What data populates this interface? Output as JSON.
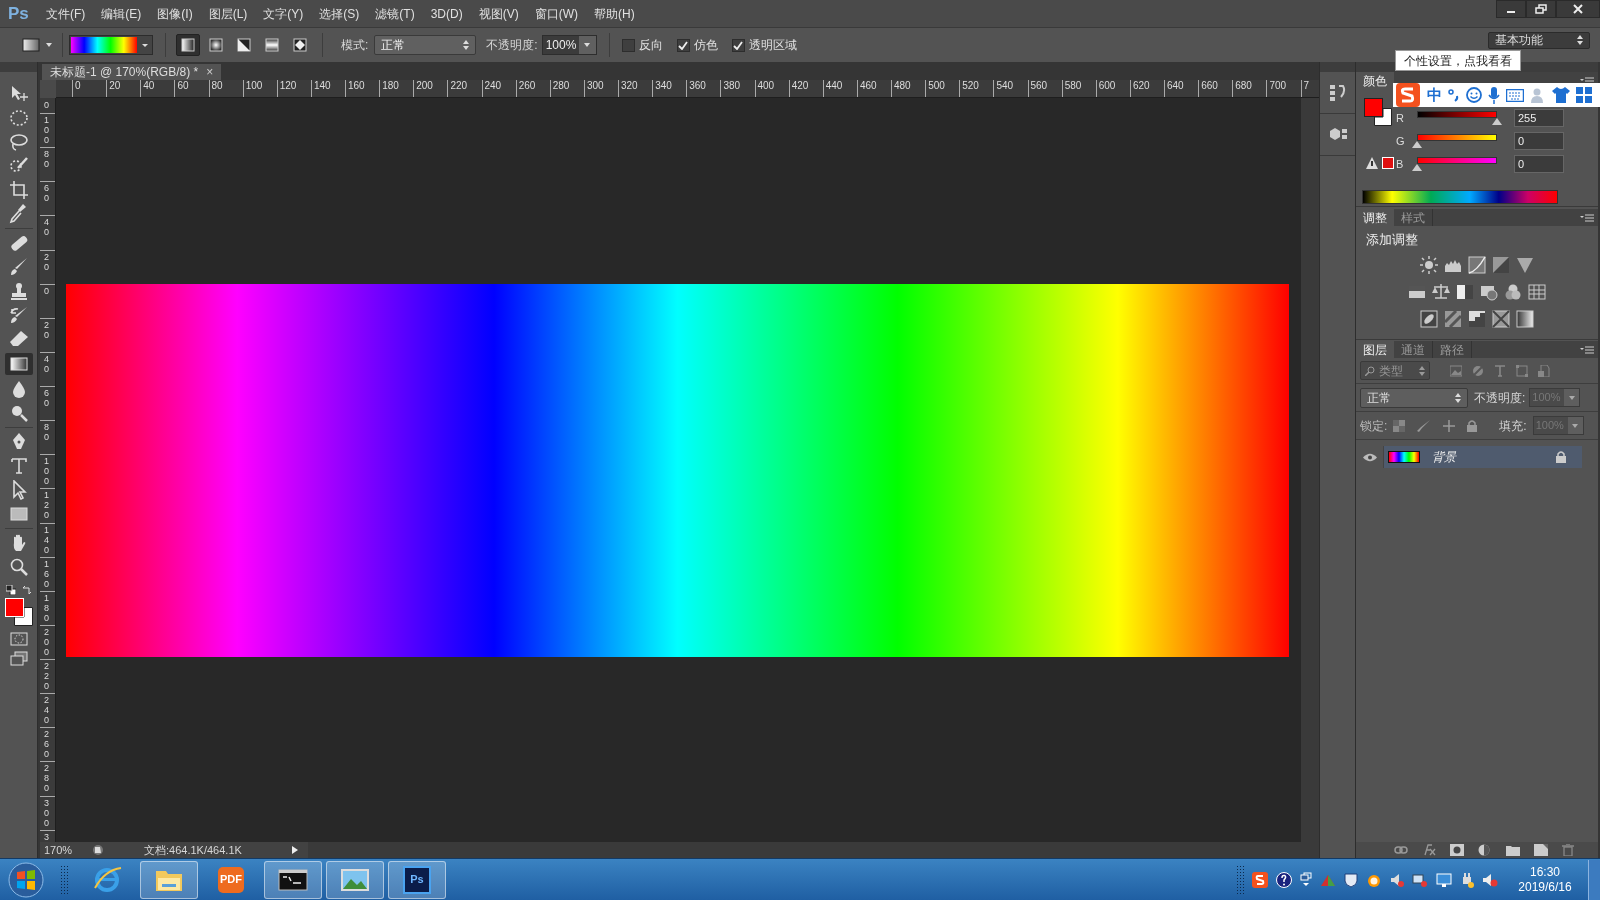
{
  "app": {
    "logo": "Ps"
  },
  "menu": [
    "文件(F)",
    "编辑(E)",
    "图像(I)",
    "图层(L)",
    "文字(Y)",
    "选择(S)",
    "滤镜(T)",
    "3D(D)",
    "视图(V)",
    "窗口(W)",
    "帮助(H)"
  ],
  "options_bar": {
    "gradient_types": [
      {
        "selected": true
      },
      {
        "selected": false
      },
      {
        "selected": false
      },
      {
        "selected": false
      },
      {
        "selected": false
      }
    ],
    "mode_label": "模式:",
    "mode": "正常",
    "opacity_label": "不透明度:",
    "opacity": "100%",
    "checkboxes": [
      {
        "label": "反向",
        "checked": false
      },
      {
        "label": "仿色",
        "checked": true
      },
      {
        "label": "透明区域",
        "checked": true
      }
    ]
  },
  "workspace": "基本功能",
  "document_tab": {
    "title": "未标题-1 @ 170%(RGB/8) *",
    "close": "×"
  },
  "horizontal_ruler": [
    "0",
    "20",
    "40",
    "60",
    "80",
    "100",
    "120",
    "140",
    "160",
    "180",
    "200",
    "220",
    "240",
    "260",
    "280",
    "300",
    "320",
    "340",
    "360",
    "380",
    "400",
    "420",
    "440",
    "460",
    "480",
    "500",
    "520",
    "540",
    "560",
    "580",
    "600",
    "620",
    "640",
    "660",
    "680",
    "700",
    "7"
  ],
  "vertical_ruler": [
    "0",
    "100",
    "80",
    "60",
    "40",
    "20",
    "0",
    "20",
    "40",
    "60",
    "80",
    "100",
    "120",
    "140",
    "160",
    "180",
    "200",
    "220",
    "240",
    "260",
    "280",
    "300",
    "3"
  ],
  "color_panel": {
    "tabs": [
      {
        "label": "颜色",
        "selected": true
      }
    ],
    "channels": [
      {
        "name": "R",
        "value": "255",
        "level": 1
      },
      {
        "name": "G",
        "value": "0",
        "level": 0
      },
      {
        "name": "B",
        "value": "0",
        "level": 0
      }
    ]
  },
  "adjustments_panel": {
    "tabs": [
      {
        "label": "调整",
        "selected": true
      },
      {
        "label": "样式",
        "selected": false
      }
    ],
    "heading": "添加调整"
  },
  "layers_panel": {
    "tabs": [
      {
        "label": "图层",
        "selected": true
      },
      {
        "label": "通道",
        "selected": false
      },
      {
        "label": "路径",
        "selected": false
      }
    ],
    "filter": "类型",
    "blend_mode": "正常",
    "opacity_label": "不透明度:",
    "opacity": "100%",
    "lock_label": "锁定:",
    "fill_label": "填充:",
    "fill": "100%",
    "layers": [
      {
        "name": "背景",
        "visible": true,
        "locked": true,
        "selected": true
      }
    ]
  },
  "status_bar": {
    "zoom": "170%",
    "document": "文档:464.1K/464.1K"
  },
  "ime": {
    "tooltip": "个性设置，点我看看",
    "mode": "中"
  },
  "taskbar": {
    "apps": [
      {
        "kind": "browser",
        "running": false
      },
      {
        "kind": "folder",
        "running": true
      },
      {
        "kind": "pdf",
        "running": false,
        "label": "PDF"
      },
      {
        "kind": "terminal",
        "running": true
      },
      {
        "kind": "photos",
        "running": true
      },
      {
        "kind": "photoshop",
        "running": true,
        "label": "Ps"
      }
    ],
    "time": "16:30",
    "date": "2019/6/16"
  }
}
